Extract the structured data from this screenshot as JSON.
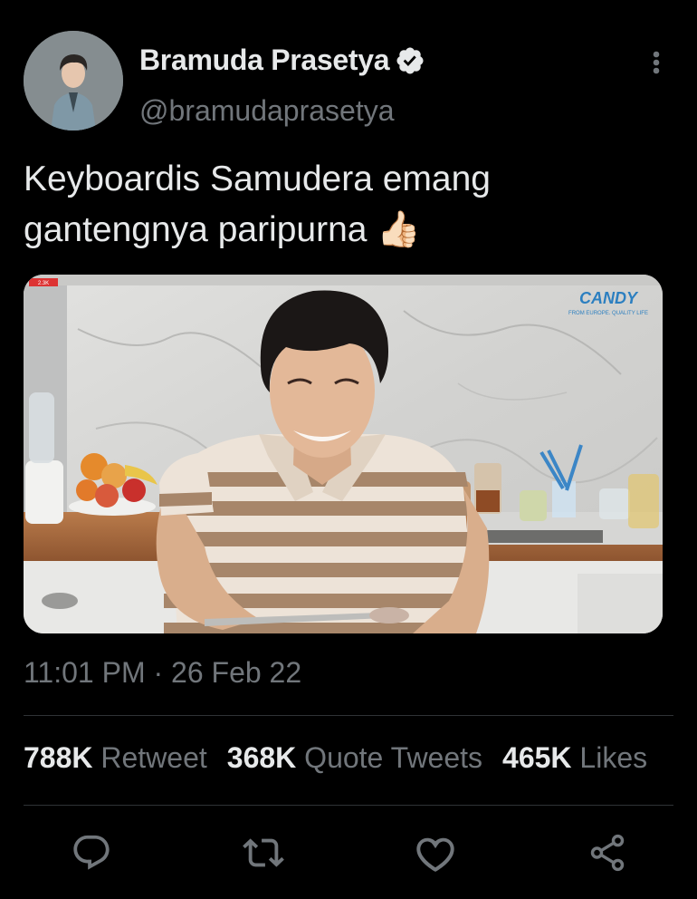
{
  "user": {
    "display_name": "Bramuda Prasetya",
    "handle": "@bramudaprasetya",
    "verified": true
  },
  "tweet": {
    "text": "Keyboardis Samudera emang gantengnya paripurna 👍🏻",
    "timestamp": "11:01 PM · 26 Feb 22"
  },
  "media": {
    "watermark_brand": "CANDY",
    "watermark_tagline": "FROM EUROPE. QUALITY LIFE",
    "live_badge": "2.3K"
  },
  "stats": {
    "retweets_count": "788K",
    "retweets_label": "Retweet",
    "quotes_count": "368K",
    "quotes_label": "Quote Tweets",
    "likes_count": "465K",
    "likes_label": "Likes"
  },
  "icons": [
    "verified-badge-icon",
    "more-options-icon",
    "reply-icon",
    "retweet-icon",
    "like-icon",
    "share-icon"
  ],
  "colors": {
    "background": "#000000",
    "text": "#e7e9ea",
    "secondary": "#71767b",
    "divider": "#2f3336"
  }
}
